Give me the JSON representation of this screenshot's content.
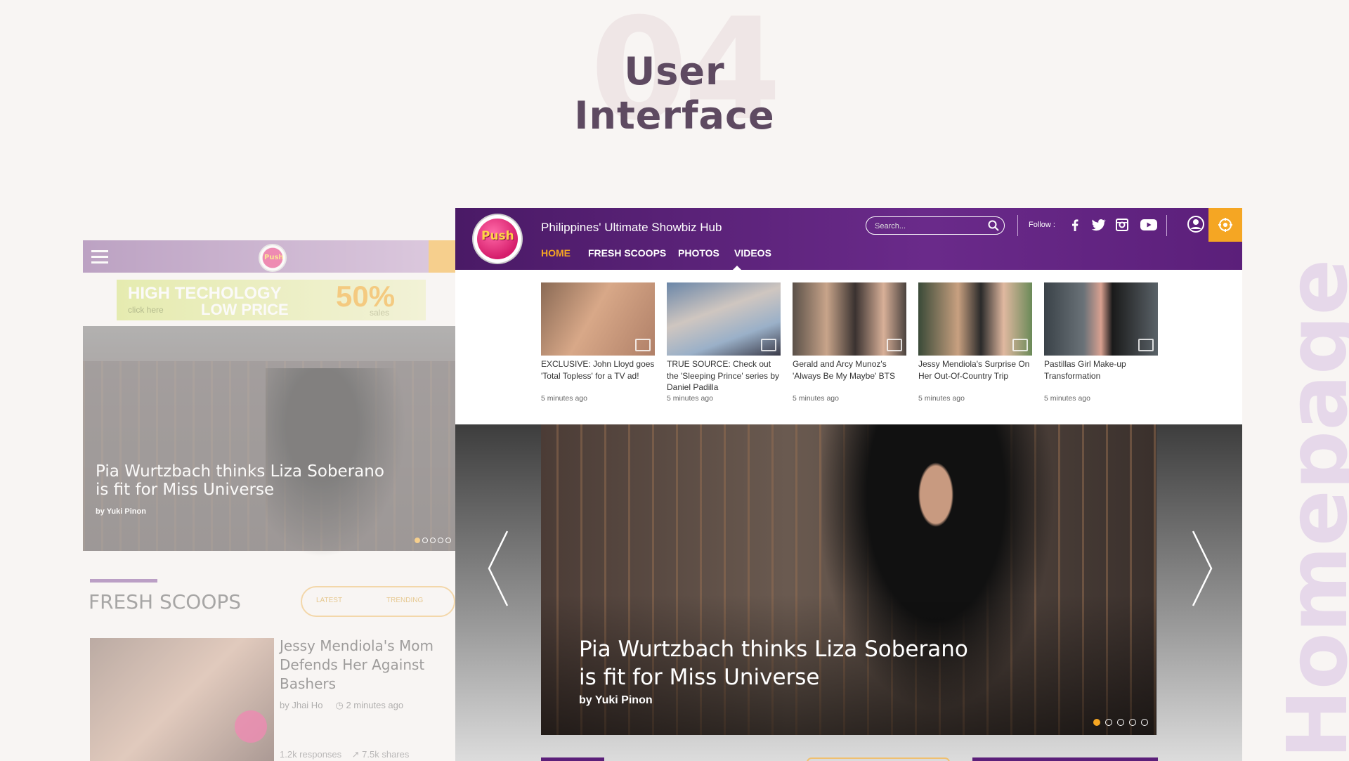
{
  "heading": {
    "number": "04",
    "title": "User Interface",
    "side_label": "Homepage"
  },
  "mobile": {
    "ad": {
      "line1": "HIGH TECHOLOGY",
      "line2": "click here",
      "line3": "LOW PRICE",
      "percent": "50%",
      "sales": "sales"
    },
    "hero": {
      "headline": "Pia Wurtzbach thinks Liza Soberano is fit for Miss Universe",
      "byline": "by Yuki Pinon"
    },
    "section_title": "FRESH SCOOPS",
    "tabs": {
      "latest": "LATEST",
      "trending": "TRENDING"
    },
    "card": {
      "title": "Jessy Mendiola's Mom Defends Her Against Bashers",
      "author": "by Jhai Ho",
      "time": "2 minutes ago",
      "responses": "1.2k responses",
      "shares": "7.5k shares"
    },
    "logo_text": "Push"
  },
  "desktop": {
    "logo_text": "Push",
    "tagline": "Philippines' Ultimate Showbiz Hub",
    "search_placeholder": "Search...",
    "follow_label": "Follow :",
    "nav": [
      "HOME",
      "FRESH SCOOPS",
      "PHOTOS",
      "VIDEOS"
    ],
    "active_nav": "HOME",
    "thumbnails": [
      {
        "caption": "EXCLUSIVE: John Lloyd goes 'Total Topless' for a TV ad!",
        "time": "5 minutes ago"
      },
      {
        "caption": "TRUE SOURCE: Check out the 'Sleeping Prince' series by Daniel Padilla",
        "time": "5 minutes ago"
      },
      {
        "caption": "Gerald and Arcy Munoz's 'Always Be My Maybe' BTS",
        "time": "5 minutes ago"
      },
      {
        "caption": "Jessy Mendiola's Surprise On Her Out-Of-Country Trip",
        "time": "5 minutes ago"
      },
      {
        "caption": "Pastillas Girl Make-up Transformation",
        "time": "5 minutes ago"
      }
    ],
    "hero": {
      "headline": "Pia Wurtzbach thinks Liza Soberano is fit for Miss Universe",
      "byline": "by Yuki Pinon",
      "slide_count": 5,
      "active_slide": 1
    },
    "social_icons": [
      "facebook-icon",
      "twitter-icon",
      "instagram-icon",
      "youtube-icon"
    ]
  },
  "colors": {
    "purple": "#5b1f7a",
    "orange": "#f5a623",
    "pink": "#d61e6c"
  }
}
